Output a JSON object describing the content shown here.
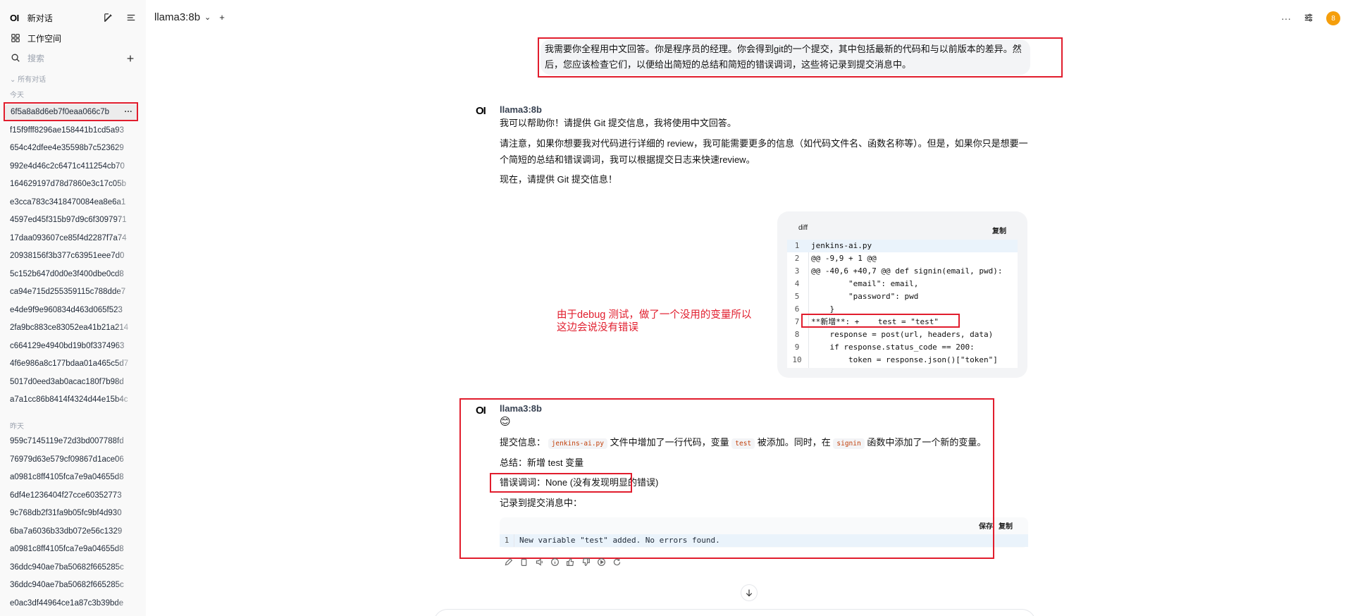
{
  "sidebar": {
    "logo": "OI",
    "new_chat": "新对话",
    "workspace": "工作空间",
    "search_placeholder": "搜索",
    "all_chats": "所有对话",
    "group_today": "今天",
    "group_yesterday": "昨天",
    "today_items": [
      "6f5a8a8d6eb7f0eaa066c7b",
      "f15f9fff8296ae158441b1cd5a93",
      "654c42dfee4e35598b7c523629",
      "992e4d46c2c6471c411254cb70",
      "164629197d78d7860e3c17c05b",
      "e3cca783c3418470084ea8e6a1",
      "4597ed45f315b97d9c6f3097971",
      "17daa093607ce85f4d2287f7a74",
      "20938156f3b377c63951eee7d0",
      "5c152b647d0d0e3f400dbe0cd8",
      "ca94e715d255359115c788dde7",
      "e4de9f9e960834d463d065f523",
      "2fa9bc883ce83052ea41b21a214",
      "c664129e4940bd19b0f3374963",
      "4f6e986a8c177bdaa01a465c5d7",
      "5017d0eed3ab0acac180f7b98d",
      "a7a1cc86b8414f4324d44e15b4c"
    ],
    "yesterday_items": [
      "959c7145119e72d3bd007788fd",
      "76979d63e579cf09867d1ace06",
      "a0981c8ff4105fca7e9a04655d8",
      "6df4e1236404f27cce60352773",
      "9c768db2f31fa9b05fc9bf4d930",
      "6ba7a6036b33db072e56c1329",
      "a0981c8ff4105fca7e9a04655d8",
      "36ddc940ae7ba50682f665285c",
      "36ddc940ae7ba50682f665285c",
      "e0ac3df44964ce1a87c3b39bde"
    ]
  },
  "topbar": {
    "model_name": "llama3:8b",
    "avatar_letter": "8"
  },
  "conversation": {
    "user_message_line1": "我需要你全程用中文回答。你是程序员的经理。你会得到git的一个提交，其中包括最新的代码和与以前版本的差异。然",
    "user_message_line2": "后，您应该检查它们，以便给出简短的总结和简短的错误调词，这些将记录到提交消息中。",
    "ai1": {
      "logo": "OI",
      "name": "llama3:8b",
      "p1": "我可以帮助你！请提供 Git 提交信息，我将使用中文回答。",
      "p2a": "请注意，如果你想要我对代码进行详细的 review，我可能需要更多的信息（如代码文件名、函数名称等）。但是，如果你只是想要一",
      "p2b": "个简短的总结和错误调词，我可以根据提交日志来快速review。",
      "p3": "现在，请提供 Git 提交信息！"
    },
    "code_block": {
      "lang": "diff",
      "copy": "复制",
      "lines": [
        {
          "n": "1",
          "t": "jenkins-ai.py"
        },
        {
          "n": "2",
          "t": "@@ -9,9 + 1 @@"
        },
        {
          "n": "3",
          "t": "@@ -40,6 +40,7 @@ def signin(email, pwd):"
        },
        {
          "n": "4",
          "t": "        \"email\": email,"
        },
        {
          "n": "5",
          "t": "        \"password\": pwd"
        },
        {
          "n": "6",
          "t": "    }"
        },
        {
          "n": "7",
          "t": "**新增**: +    test = \"test\""
        },
        {
          "n": "8",
          "t": "    response = post(url, headers, data)"
        },
        {
          "n": "9",
          "t": "    if response.status_code == 200:"
        },
        {
          "n": "10",
          "t": "        token = response.json()[\"token\"]"
        }
      ]
    },
    "annotation_line1": "由于debug 测试，做了一个没用的变量所以",
    "annotation_line2": "这边会说没有错误",
    "ai2": {
      "logo": "OI",
      "name": "llama3:8b",
      "emoji": "😊",
      "commit_label": "提交信息：",
      "code_file": "jenkins-ai.py",
      "commit_mid1": " 文件中增加了一行代码，变量 ",
      "code_var": "test",
      "commit_mid2": " 被添加。同时，在 ",
      "code_fn": "signin",
      "commit_end": " 函数中添加了一个新的变量。",
      "summary": "总结：新增 test 变量",
      "error": "错误调词：None (没有发现明显的错误)",
      "record": "记录到提交消息中：",
      "save": "保存",
      "copy": "复制",
      "code_line_num": "1",
      "code_line": "New variable \"test\" added. No errors found."
    }
  }
}
